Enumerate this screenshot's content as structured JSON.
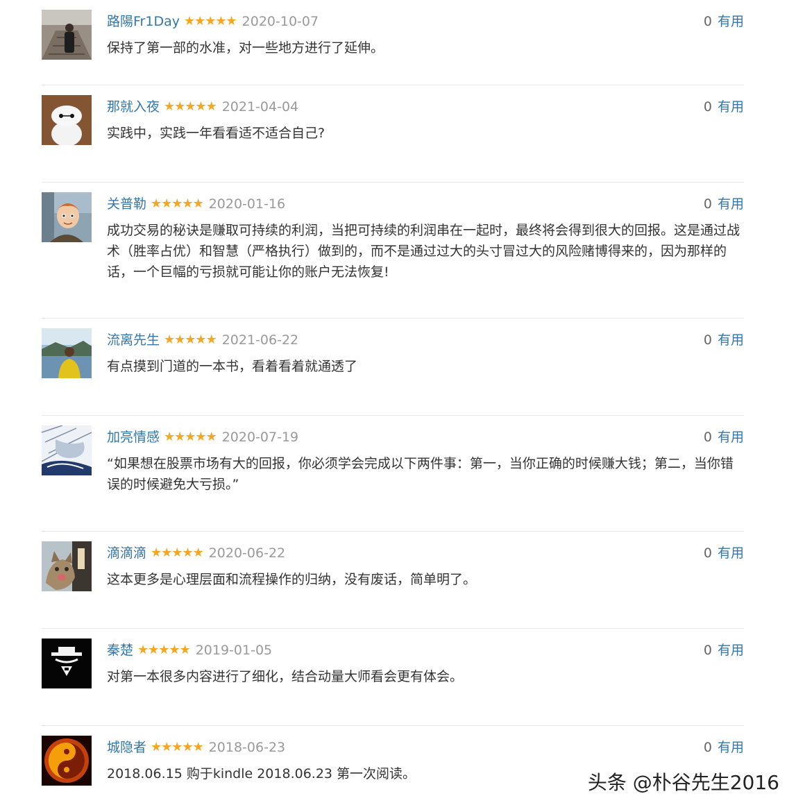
{
  "vote_label": "有用",
  "star_color": "#f5a623",
  "link_color": "#3377aa",
  "watermark": "头条 @朴谷先生2016",
  "comments": [
    {
      "user": "路陽Fr1Day",
      "stars": "★★★★★",
      "rating": 5,
      "date": "2020-10-07",
      "votes": "0",
      "text": "保持了第一部的水准，对一些地方进行了延伸。",
      "avatar_icon": "man-on-railway-avatar"
    },
    {
      "user": "那就入夜",
      "stars": "★★★★★",
      "rating": 5,
      "date": "2021-04-04",
      "votes": "0",
      "text": "实践中，实践一年看看适不适合自己?",
      "avatar_icon": "white-robot-avatar"
    },
    {
      "user": "关普勒",
      "stars": "★★★★★",
      "rating": 5,
      "date": "2020-01-16",
      "votes": "0",
      "text": "成功交易的秘诀是赚取可持续的利润，当把可持续的利润串在一起时，最终将会得到很大的回报。这是通过战术（胜率占优）和智慧（严格执行）做到的，而不是通过过大的头寸冒过大的风险赌博得来的，因为那样的话，一个巨幅的亏损就可能让你的账户无法恢复!",
      "avatar_icon": "cartoon-boy-avatar"
    },
    {
      "user": "流离先生",
      "stars": "★★★★★",
      "rating": 5,
      "date": "2021-06-22",
      "votes": "0",
      "text": "有点摸到门道的一本书，看着看着就通透了",
      "avatar_icon": "man-by-lake-avatar"
    },
    {
      "user": "加亮情感",
      "stars": "★★★★★",
      "rating": 5,
      "date": "2020-07-19",
      "votes": "0",
      "text": "“如果想在股票市场有大的回报，你必须学会完成以下两件事：第一，当你正确的时候赚大钱；第二，当你错误的时候避免大亏损。”",
      "avatar_icon": "sketch-drawing-avatar"
    },
    {
      "user": "滴滴滴",
      "stars": "★★★★★",
      "rating": 5,
      "date": "2020-06-22",
      "votes": "0",
      "text": "这本更多是心理层面和流程操作的归纳，没有废话，简单明了。",
      "avatar_icon": "cat-photo-avatar"
    },
    {
      "user": "秦楚",
      "stars": "★★★★★",
      "rating": 5,
      "date": "2019-01-05",
      "votes": "0",
      "text": "对第一本很多内容进行了细化，结合动量大师看会更有体会。",
      "avatar_icon": "masked-hat-avatar"
    },
    {
      "user": "城隐者",
      "stars": "★★★★★",
      "rating": 5,
      "date": "2018-06-23",
      "votes": "0",
      "text": "2018.06.15 购于kindle 2018.06.23 第一次阅读。",
      "avatar_icon": "yin-yang-fire-avatar"
    }
  ]
}
